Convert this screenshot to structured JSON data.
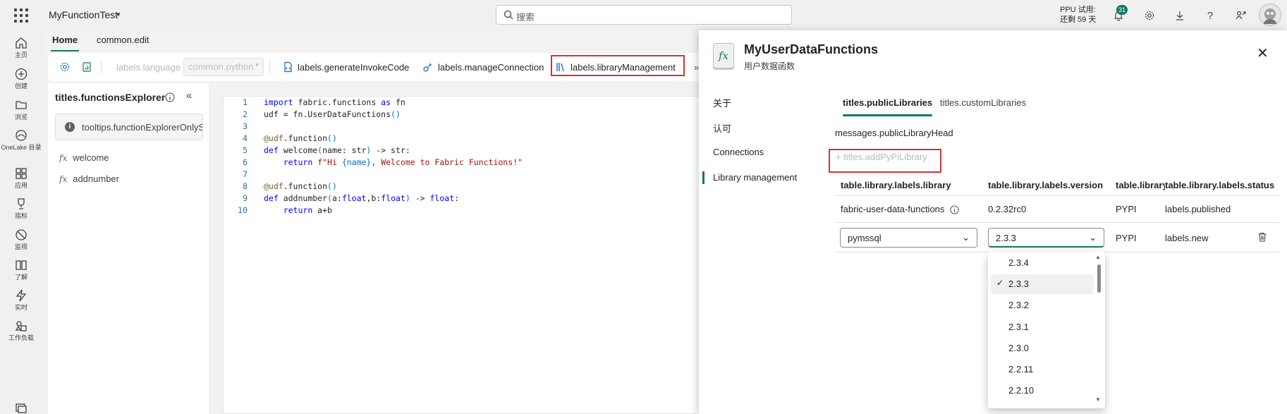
{
  "topbar": {
    "workspace": "MyFunctionTest",
    "search_placeholder": "搜索",
    "trial_line1": "PPU 试用:",
    "trial_line2": "还剩 59 天",
    "notification_count": "31"
  },
  "rail": {
    "items": [
      {
        "label": "主页",
        "icon": "home-icon"
      },
      {
        "label": "创建",
        "icon": "plus-circle-icon"
      },
      {
        "label": "浏览",
        "icon": "folder-icon"
      },
      {
        "label": "OneLake 目录",
        "icon": "onelake-icon"
      },
      {
        "label": "应用",
        "icon": "apps-icon"
      },
      {
        "label": "指标",
        "icon": "trophy-icon"
      },
      {
        "label": "监视",
        "icon": "monitor-icon"
      },
      {
        "label": "了解",
        "icon": "book-icon"
      },
      {
        "label": "实时",
        "icon": "lightning-icon"
      },
      {
        "label": "工作负载",
        "icon": "workload-icon"
      }
    ]
  },
  "main": {
    "tabs": [
      "Home",
      "common.edit"
    ],
    "toolbar": {
      "language_label": "labels.language",
      "language_value": "common.python",
      "generate": "labels.generateInvokeCode",
      "manage": "labels.manageConnection",
      "library": "labels.libraryManagement"
    },
    "explorer": {
      "title": "titles.functionsExplorer",
      "tip": "tooltips.functionExplorerOnlyShow",
      "functions": [
        "welcome",
        "addnumber"
      ]
    },
    "code_lines": [
      "import fabric.functions as fn",
      "udf = fn.UserDataFunctions()",
      "",
      "@udf.function()",
      "def welcome(name: str) -> str:",
      "    return f\"Hi {name}, Welcome to Fabric Functions!\"",
      "",
      "@udf.function()",
      "def addnumber(a:float,b:float) -> float:",
      "    return a+b"
    ]
  },
  "panel": {
    "title": "MyUserDataFunctions",
    "subtitle": "用户数据函数",
    "nav": [
      "关于",
      "认可",
      "Connections",
      "Library management"
    ],
    "tabs": [
      "titles.publicLibraries",
      "titles.customLibraries"
    ],
    "head": "messages.publicLibraryHead",
    "add_button": "titles.addPyPiLibrary",
    "columns": [
      "table.library.labels.library",
      "table.library.labels.version",
      "table.library.labels.source",
      "table.library.labels.status"
    ],
    "rows": [
      {
        "library": "fabric-user-data-functions",
        "version": "0.2.32rc0",
        "source": "PYPI",
        "status": "labels.published"
      },
      {
        "library": "pymssql",
        "version": "2.3.3",
        "source": "PYPI",
        "status": "labels.new"
      }
    ],
    "version_options": [
      "2.3.4",
      "2.3.3",
      "2.3.2",
      "2.3.1",
      "2.3.0",
      "2.2.11",
      "2.2.10"
    ],
    "selected_version": "2.3.3"
  }
}
